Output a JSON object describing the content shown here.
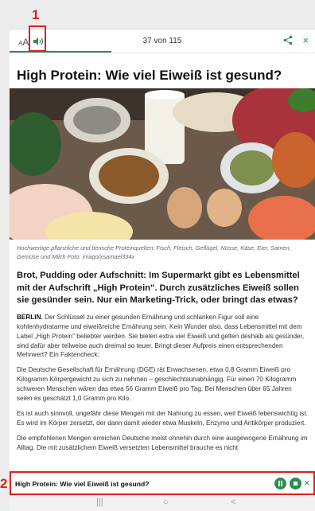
{
  "annotations": {
    "marker1": "1",
    "marker2": "2"
  },
  "topbar": {
    "font_size_icon_small": "A",
    "font_size_icon_large": "A",
    "counter": "37 von 115",
    "close": "×"
  },
  "article": {
    "title": "High Protein: Wie viel Eiweiß ist gesund?",
    "caption": "Hochwertige pflanzliche und tierische Proteinquellen: Fisch, Fleisch, Geflügel, Nüsse, Käse, Eier, Samen, Gemüse und Milch Foto: imago/xsamael334x",
    "lead": "Brot, Pudding oder Aufschnitt: Im Supermarkt gibt es Lebensmittel mit der Aufschrift „High Protein\". Durch zusätzliches Eiweiß sollen sie gesünder sein. Nur ein Marketing-Trick, oder bringt das etwas?",
    "p1_strong": "BERLIN.",
    "p1": " Der Schlüssel zu einer gesunden Ernährung und schlanken Figur soll eine kohlenhydratarme und eiweißreiche Ernährung sein. Kein Wunder also, dass Lebensmittel mit dem Label „High Protein\" beliebter werden. Sie bieten extra viel Eiweiß und gelten deshalb als gesünder, sind dafür aber teilweise auch dreimal so teuer. Bringt dieser Aufpreis einen entsprechenden Mehrwert? Ein Faktencheck:",
    "p2": "Die Deutsche Gesellschaft für Ernährung (DGE) rät Erwachsenen, etwa 0,8 Gramm Eiweiß pro Kilogramm Körpergewicht zu sich zu nehmen – geschlechtsunabhängig. Für einen 70 Kilogramm schweren Menschen wären das etwa 56 Gramm Eiweiß pro Tag. Bei Menschen über 65 Jahren seien es geschätzt 1,0 Gramm pro Kilo.",
    "p3": "Es ist auch sinnvoll, ungefähr diese Mengen mit der Nahrung zu essen, weil Eiweiß lebenswichtig ist. Es wird im Körper zersetzt, der dann damit wieder etwa Muskeln, Enzyme und Antikörper produziert.",
    "p4": "Die empfohlenen Mengen erreichen Deutsche meist ohnehin durch eine ausgewogene Ernährung im Alltag. Die mit zusätzlichem Eiweiß versetzten Lebensmittel brauche es nicht"
  },
  "audio_bar": {
    "title": "High Protein: Wie viel Eiweiß ist gesund?",
    "close": "×"
  },
  "navbar": {
    "recent": "|||",
    "home": "○",
    "back": "<"
  },
  "colors": {
    "accent": "#2e8b57",
    "annotation": "#e02020"
  }
}
